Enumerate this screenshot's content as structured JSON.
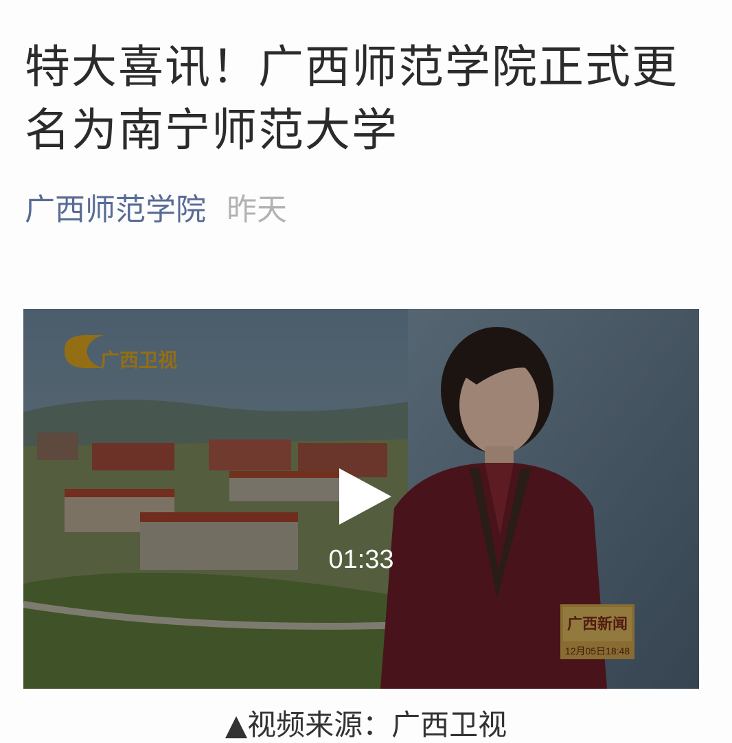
{
  "article": {
    "title": "特大喜讯！广西师范学院正式更名为南宁师范大学",
    "account_name": "广西师范学院",
    "publish_time": "昨天"
  },
  "video": {
    "duration": "01:33",
    "channel_logo_text": "广西卫视",
    "news_bug_text": "广西新闻",
    "news_bug_time": "12月05日18:48"
  },
  "caption": "▲视频来源：广西卫视",
  "colors": {
    "title": "#2b2b2b",
    "account_link": "#576b95",
    "date": "#b2b2b2",
    "caption": "#333333"
  },
  "icons": {
    "play": "play-icon",
    "caption_marker": "triangle-up-icon"
  }
}
